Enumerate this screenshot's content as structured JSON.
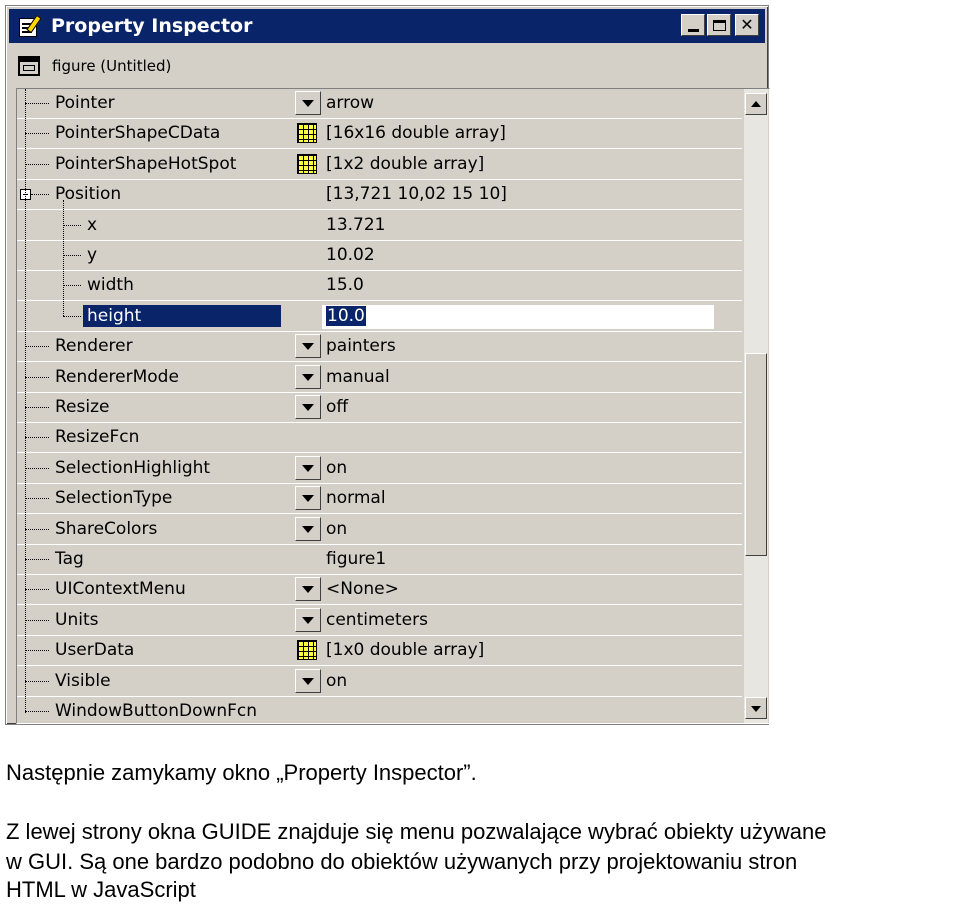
{
  "window": {
    "title": "Property Inspector",
    "object_label": "figure (Untitled)"
  },
  "scroll": {
    "position_fraction": 0.62,
    "visible_fraction": 0.35
  },
  "properties": [
    {
      "name": "Pointer",
      "value": "arrow",
      "control": "dropdown"
    },
    {
      "name": "PointerShapeCData",
      "value": "[16x16  double array]",
      "control": "array"
    },
    {
      "name": "PointerShapeHotSpot",
      "value": "[1x2  double array]",
      "control": "array"
    },
    {
      "name": "Position",
      "value": "[13,721 10,02 15 10]",
      "control": "expander"
    },
    {
      "name": "x",
      "value": "13.721",
      "control": "child"
    },
    {
      "name": "y",
      "value": "10.02",
      "control": "child"
    },
    {
      "name": "width",
      "value": "15.0",
      "control": "child"
    },
    {
      "name": "height",
      "value": "10.0",
      "control": "child-selected"
    },
    {
      "name": "Renderer",
      "value": "painters",
      "control": "dropdown"
    },
    {
      "name": "RendererMode",
      "value": "manual",
      "control": "dropdown"
    },
    {
      "name": "Resize",
      "value": "off",
      "control": "dropdown"
    },
    {
      "name": "ResizeFcn",
      "value": "",
      "control": "none"
    },
    {
      "name": "SelectionHighlight",
      "value": "on",
      "control": "dropdown"
    },
    {
      "name": "SelectionType",
      "value": "normal",
      "control": "dropdown"
    },
    {
      "name": "ShareColors",
      "value": "on",
      "control": "dropdown"
    },
    {
      "name": "Tag",
      "value": "figure1",
      "control": "none"
    },
    {
      "name": "UIContextMenu",
      "value": "<None>",
      "control": "dropdown"
    },
    {
      "name": "Units",
      "value": "centimeters",
      "control": "dropdown"
    },
    {
      "name": "UserData",
      "value": "[1x0  double array]",
      "control": "array"
    },
    {
      "name": "Visible",
      "value": "on",
      "control": "dropdown"
    },
    {
      "name": "WindowButtonDownFcn",
      "value": "",
      "control": "none"
    }
  ],
  "text": {
    "para1": "Następnie zamykamy okno „Property Inspector”.",
    "para2_line1": "Z lewej strony okna GUIDE znajduje się menu pozwalające wybrać obiekty używane",
    "para2_line2": "w GUI. Są one bardzo podobno do obiektów używanych przy projektowaniu stron",
    "para2_line3": "HTML w JavaScript"
  }
}
